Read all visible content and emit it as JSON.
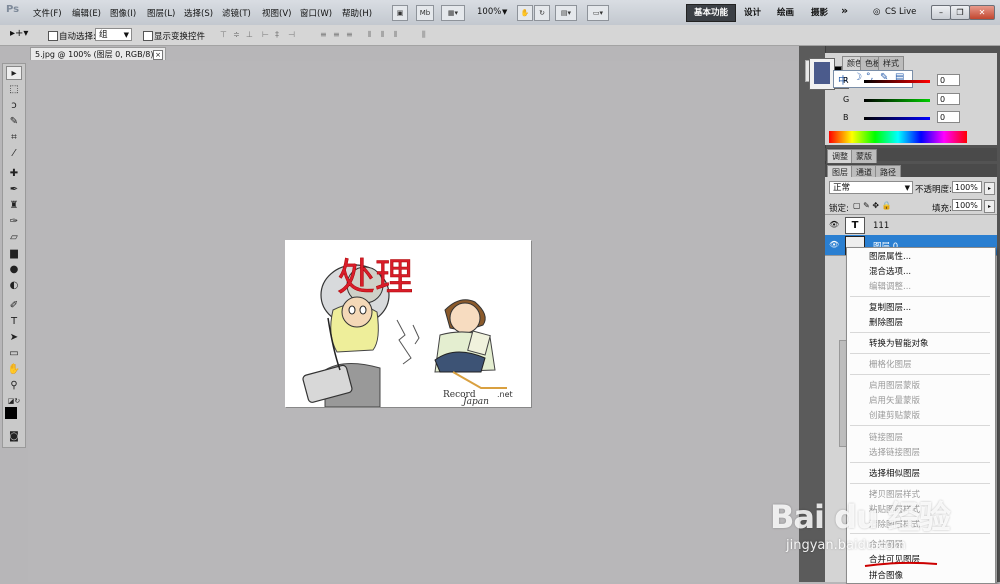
{
  "app": {
    "logo": "Ps"
  },
  "menu": [
    "文件(F)",
    "编辑(E)",
    "图像(I)",
    "图层(L)",
    "选择(S)",
    "滤镜(T)",
    "视图(V)",
    "窗口(W)",
    "帮助(H)"
  ],
  "menubar_buttons": {
    "mb": "Mb",
    "zoom": "100%"
  },
  "workspaces": {
    "active": "基本功能",
    "design": "设计",
    "painting": "绘画",
    "photography": "摄影",
    "more": "»"
  },
  "cs_live": "CS Live",
  "options": {
    "auto_select_label": "自动选择:",
    "auto_select_value": "组",
    "show_transform_label": "显示变换控件"
  },
  "document": {
    "tab_title": "5.jpg @ 100% (图层 0, RGB/8) *",
    "close_glyph": "×"
  },
  "image_text": {
    "headline": "处理",
    "logo_text": "Record",
    "logo_script": "Japan",
    "logo_net": ".net"
  },
  "color_panel": {
    "tabs": [
      "颜色",
      "色板",
      "样式"
    ],
    "r_label": "R",
    "g_label": "G",
    "b_label": "B",
    "r_value": "0",
    "g_value": "0",
    "b_value": "0"
  },
  "adjust_tabs": [
    "调整",
    "蒙版"
  ],
  "layers_panel": {
    "tabs": [
      "图层",
      "通道",
      "路径"
    ],
    "blend_mode": "正常",
    "opacity_label": "不透明度:",
    "opacity_value": "100%",
    "lock_label": "锁定:",
    "fill_label": "填充:",
    "fill_value": "100%",
    "layers": [
      {
        "name": "111",
        "thumb": "T"
      },
      {
        "name": "图层 0",
        "thumb": ""
      }
    ]
  },
  "context_menu": {
    "items": [
      {
        "label": "图层属性...",
        "enabled": true
      },
      {
        "label": "混合选项...",
        "enabled": true
      },
      {
        "label": "编辑调整...",
        "enabled": false
      },
      {
        "label": "复制图层...",
        "enabled": true
      },
      {
        "label": "删除图层",
        "enabled": true
      },
      {
        "label": "转换为智能对象",
        "enabled": true
      },
      {
        "label": "栅格化图层",
        "enabled": false
      },
      {
        "label": "启用图层蒙版",
        "enabled": false
      },
      {
        "label": "启用矢量蒙版",
        "enabled": false
      },
      {
        "label": "创建剪贴蒙版",
        "enabled": false
      },
      {
        "label": "链接图层",
        "enabled": false
      },
      {
        "label": "选择链接图层",
        "enabled": false
      },
      {
        "label": "选择相似图层",
        "enabled": true
      },
      {
        "label": "拷贝图层样式",
        "enabled": false
      },
      {
        "label": "粘贴图层样式",
        "enabled": false
      },
      {
        "label": "清除图层样式",
        "enabled": false
      },
      {
        "label": "合并图层",
        "enabled": false
      },
      {
        "label": "合并可见图层",
        "enabled": true
      },
      {
        "label": "拼合图像",
        "enabled": true
      }
    ],
    "highlight_color": "#cc0000"
  },
  "watermark": {
    "brand": "Bai du 经验",
    "site": "jingyan.baidu.com"
  },
  "colors": {
    "accent": "#2a7fd1",
    "headline": "#d81d2a"
  }
}
